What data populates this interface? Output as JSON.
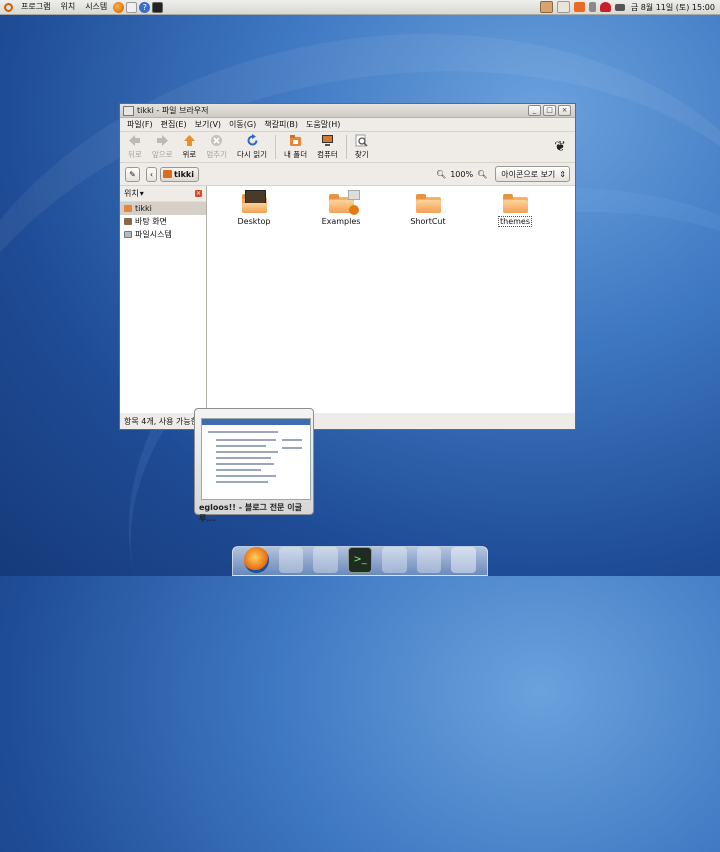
{
  "panel": {
    "menus": [
      "프로그램",
      "위치",
      "시스템"
    ],
    "clock": "금 8월 11일 (토) 15:00"
  },
  "window": {
    "title": "tikki - 파일 브라우저",
    "menus": [
      "파일(F)",
      "편집(E)",
      "보기(V)",
      "이동(G)",
      "책갈피(B)",
      "도움말(H)"
    ],
    "toolbar": {
      "back": "뒤로",
      "forward": "앞으로",
      "up": "위로",
      "stop": "멈추기",
      "reload": "다시 읽기",
      "home": "내 폴더",
      "computer": "컴퓨터",
      "search": "찾기"
    },
    "location": {
      "crumb": "tikki",
      "zoom": "100%",
      "view_mode": "아이콘으로 보기"
    },
    "sidebar": {
      "title": "위치",
      "items": [
        "tikki",
        "바탕 화면",
        "파일시스템"
      ]
    },
    "files": [
      "Desktop",
      "Examples",
      "ShortCut",
      "themes"
    ],
    "status": "항목 4개, 사용 가능한"
  },
  "preview": {
    "title": "egloos!! - 블로그 전문 이글루..."
  },
  "colors": {
    "accent": "#e8843a",
    "desktop": "#2d62b0"
  }
}
